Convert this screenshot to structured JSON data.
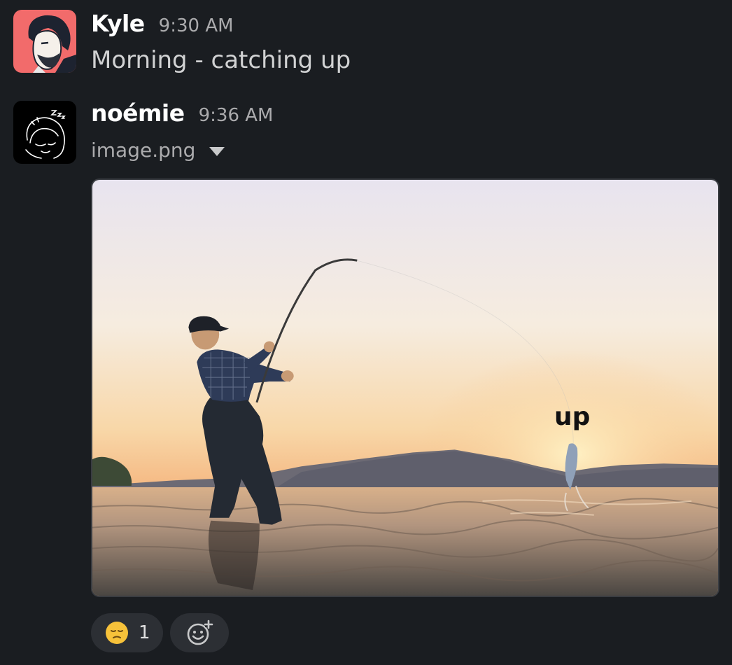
{
  "messages": [
    {
      "author": "Kyle",
      "time": "9:30 AM",
      "text": "Morning - catching up",
      "avatar_icon": "kyle-avatar"
    },
    {
      "author": "noémie",
      "time": "9:36 AM",
      "file_name": "image.png",
      "avatar_icon": "noemie-avatar",
      "image_overlay_text": "up",
      "reactions": [
        {
          "emoji": "pensive-face",
          "count": "1"
        }
      ],
      "add_reaction_icon": "add-reaction-icon"
    }
  ],
  "colors": {
    "background": "#1a1d21",
    "kyle_avatar_bg": "#f26b6b",
    "reaction_bg": "#2c2f34"
  }
}
